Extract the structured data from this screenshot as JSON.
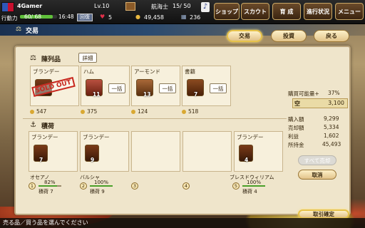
{
  "topbar": {
    "player_name": "4Gamer",
    "level": "Lv.10",
    "navigator_label": "航海士",
    "navigator_count": "15/ 50",
    "stamina_label": "行動力",
    "stamina_value": "60/ 68",
    "time": "16:48",
    "recover_label": "回復",
    "hearts": "5",
    "gold": "49,458",
    "items": "236",
    "menu": [
      "ショップ",
      "スカウト",
      "育 成",
      "進行状況",
      "メニュー"
    ]
  },
  "title": "交易",
  "tabs": [
    "交易",
    "投資",
    "戻る"
  ],
  "display": {
    "label": "陳列品",
    "detail_btn": "詳細",
    "bulk_label": "一括",
    "sold_out": "SOLD OUT",
    "items": [
      {
        "name": "ブランデー",
        "price": "547",
        "qty": ""
      },
      {
        "name": "ハム",
        "price": "375",
        "qty": "11"
      },
      {
        "name": "アーモンド",
        "price": "124",
        "qty": "13"
      },
      {
        "name": "書籍",
        "price": "518",
        "qty": "7"
      }
    ]
  },
  "cargo": {
    "label": "積荷",
    "slots": [
      {
        "name": "ブランデー",
        "qty": "7"
      },
      {
        "name": "ブランデー",
        "qty": "9"
      },
      {
        "name": "",
        "qty": ""
      },
      {
        "name": "",
        "qty": ""
      },
      {
        "name": "ブランデー",
        "qty": "4"
      }
    ],
    "ships": [
      {
        "num": "1",
        "name": "オセアノ",
        "pct": "82%",
        "cargo": "積荷 7",
        "fill": 0.82
      },
      {
        "num": "2",
        "name": "バルシャ",
        "pct": "100%",
        "cargo": "積荷 9",
        "fill": 1.0
      },
      {
        "num": "3",
        "name": "",
        "pct": "",
        "cargo": "",
        "fill": 0
      },
      {
        "num": "4",
        "name": "",
        "pct": "",
        "cargo": "",
        "fill": 0
      },
      {
        "num": "5",
        "name": "ブレスドウィリアム",
        "pct": "100%",
        "cargo": "積荷 4",
        "fill": 1.0
      }
    ]
  },
  "summary": {
    "buy_power_label": "購買可能量+",
    "buy_power_value": "37%",
    "capacity_icon": "空",
    "capacity_value": "3,100",
    "rows": [
      {
        "label": "購入額",
        "value": "9,299"
      },
      {
        "label": "売却額",
        "value": "5,334"
      },
      {
        "label": "利益",
        "value": "1,602"
      },
      {
        "label": "所持金",
        "value": "45,493"
      }
    ],
    "sell_all": "すべて売却",
    "cancel": "取消",
    "confirm": "取引確定"
  },
  "status_bar": "売る品／買う品を選んでください"
}
